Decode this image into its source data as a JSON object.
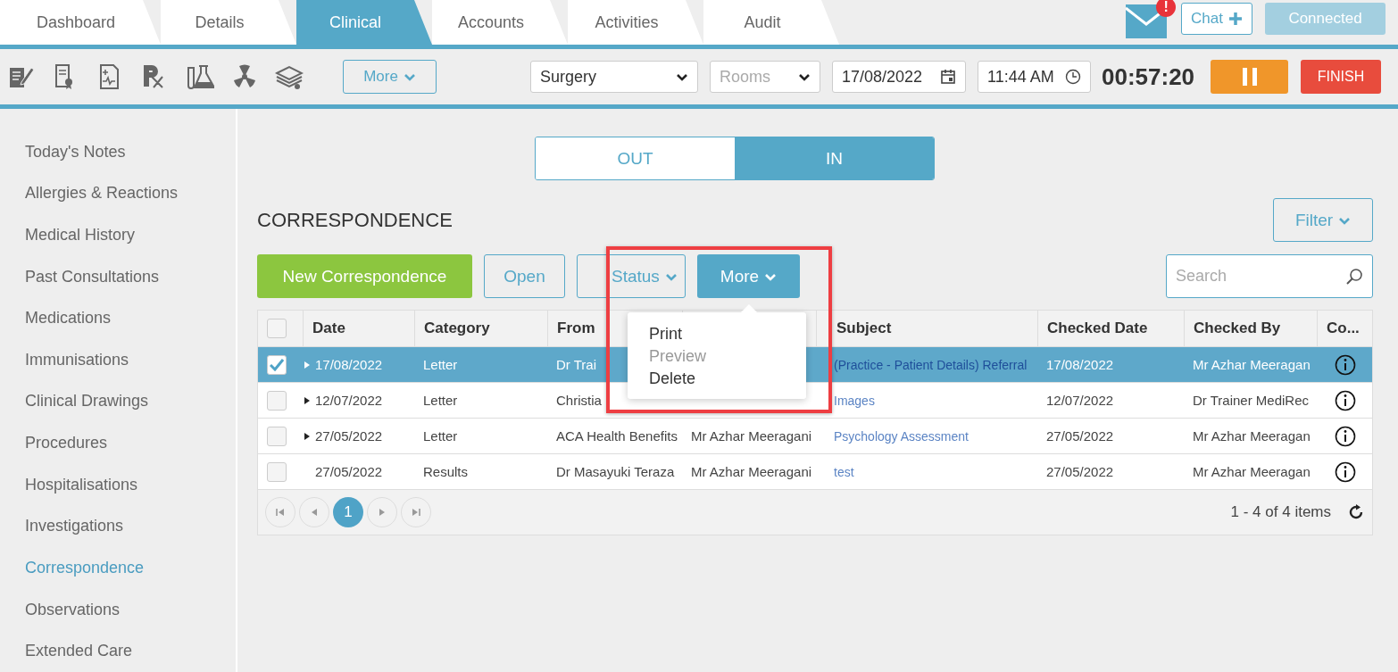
{
  "tabs": [
    {
      "label": "Dashboard",
      "selected": false
    },
    {
      "label": "Details",
      "selected": false
    },
    {
      "label": "Clinical",
      "selected": true
    },
    {
      "label": "Accounts",
      "selected": false
    },
    {
      "label": "Activities",
      "selected": false
    },
    {
      "label": "Audit",
      "selected": false
    }
  ],
  "header": {
    "alert_badge": "!",
    "chat_button": "Chat",
    "connection_button": {
      "label": "Connected",
      "disabled": true
    }
  },
  "toolbar": {
    "more_button": "More",
    "location": {
      "value": "Surgery"
    },
    "rooms": {
      "placeholder": "Rooms"
    },
    "date": "17/08/2022",
    "time": "11:44 AM",
    "timer": "00:57:20",
    "finish_button": "FINISH"
  },
  "sidebar": {
    "items": [
      {
        "label": "Today's Notes",
        "selected": false
      },
      {
        "label": "Allergies & Reactions",
        "selected": false
      },
      {
        "label": "Medical History",
        "selected": false
      },
      {
        "label": "Past Consultations",
        "selected": false
      },
      {
        "label": "Medications",
        "selected": false
      },
      {
        "label": "Immunisations",
        "selected": false
      },
      {
        "label": "Clinical Drawings",
        "selected": false
      },
      {
        "label": "Procedures",
        "selected": false
      },
      {
        "label": "Hospitalisations",
        "selected": false
      },
      {
        "label": "Investigations",
        "selected": false
      },
      {
        "label": "Correspondence",
        "selected": true
      },
      {
        "label": "Observations",
        "selected": false
      },
      {
        "label": "Extended Care",
        "selected": false
      }
    ]
  },
  "direction": [
    {
      "label": "OUT",
      "selected": false
    },
    {
      "label": "IN",
      "selected": true
    }
  ],
  "title": "CORRESPONDENCE",
  "filter_button": "Filter",
  "actions": [
    {
      "label": "New Correspondence",
      "kind": "primary"
    },
    {
      "label": "Open",
      "kind": "outline"
    },
    {
      "label": "Status",
      "kind": "dropdown"
    },
    {
      "label": "More",
      "kind": "active-dropdown"
    }
  ],
  "search": {
    "placeholder": "Search"
  },
  "menu": [
    {
      "label": "Print",
      "disabled": false
    },
    {
      "label": "Preview",
      "disabled": true
    },
    {
      "label": "Delete",
      "disabled": false
    }
  ],
  "table": {
    "select_all_checked": false,
    "columns": [
      {
        "label": "Date"
      },
      {
        "label": "Category"
      },
      {
        "label": "From"
      },
      {},
      {
        "label": "Subject"
      },
      {
        "label": "Checked Date"
      },
      {
        "label": "Checked By"
      },
      {
        "label": "Co..."
      }
    ],
    "rows": [
      {
        "selected": true,
        "checked": true,
        "expandable": true,
        "date": "17/08/2022",
        "category": "Letter",
        "from": "Dr Trai",
        "subject": "(Practice - Patient Details) Referral",
        "checked_date": "17/08/2022",
        "checked_by": "Mr Azhar Meeragan"
      },
      {
        "selected": false,
        "checked": false,
        "expandable": true,
        "date": "12/07/2022",
        "category": "Letter",
        "from": "Christia",
        "subject": "Images",
        "checked_date": "12/07/2022",
        "checked_by": "Dr Trainer MediRec"
      },
      {
        "selected": false,
        "checked": false,
        "expandable": true,
        "date": "27/05/2022",
        "category": "Letter",
        "from": "ACA Health Benefits",
        "to": "Mr Azhar Meeragani",
        "subject": "Psychology Assessment",
        "checked_date": "27/05/2022",
        "checked_by": "Mr Azhar Meeragan"
      },
      {
        "selected": false,
        "checked": false,
        "expandable": false,
        "date": "27/05/2022",
        "category": "Results",
        "from": "Dr Masayuki Teraza",
        "to": "Mr Azhar Meeragani",
        "subject": "test",
        "checked_date": "27/05/2022",
        "checked_by": "Mr Azhar Meeragan"
      }
    ]
  },
  "pager": {
    "pages": [
      {
        "label": "1",
        "selected": true
      }
    ],
    "summary": "1 - 4 of 4 items"
  }
}
